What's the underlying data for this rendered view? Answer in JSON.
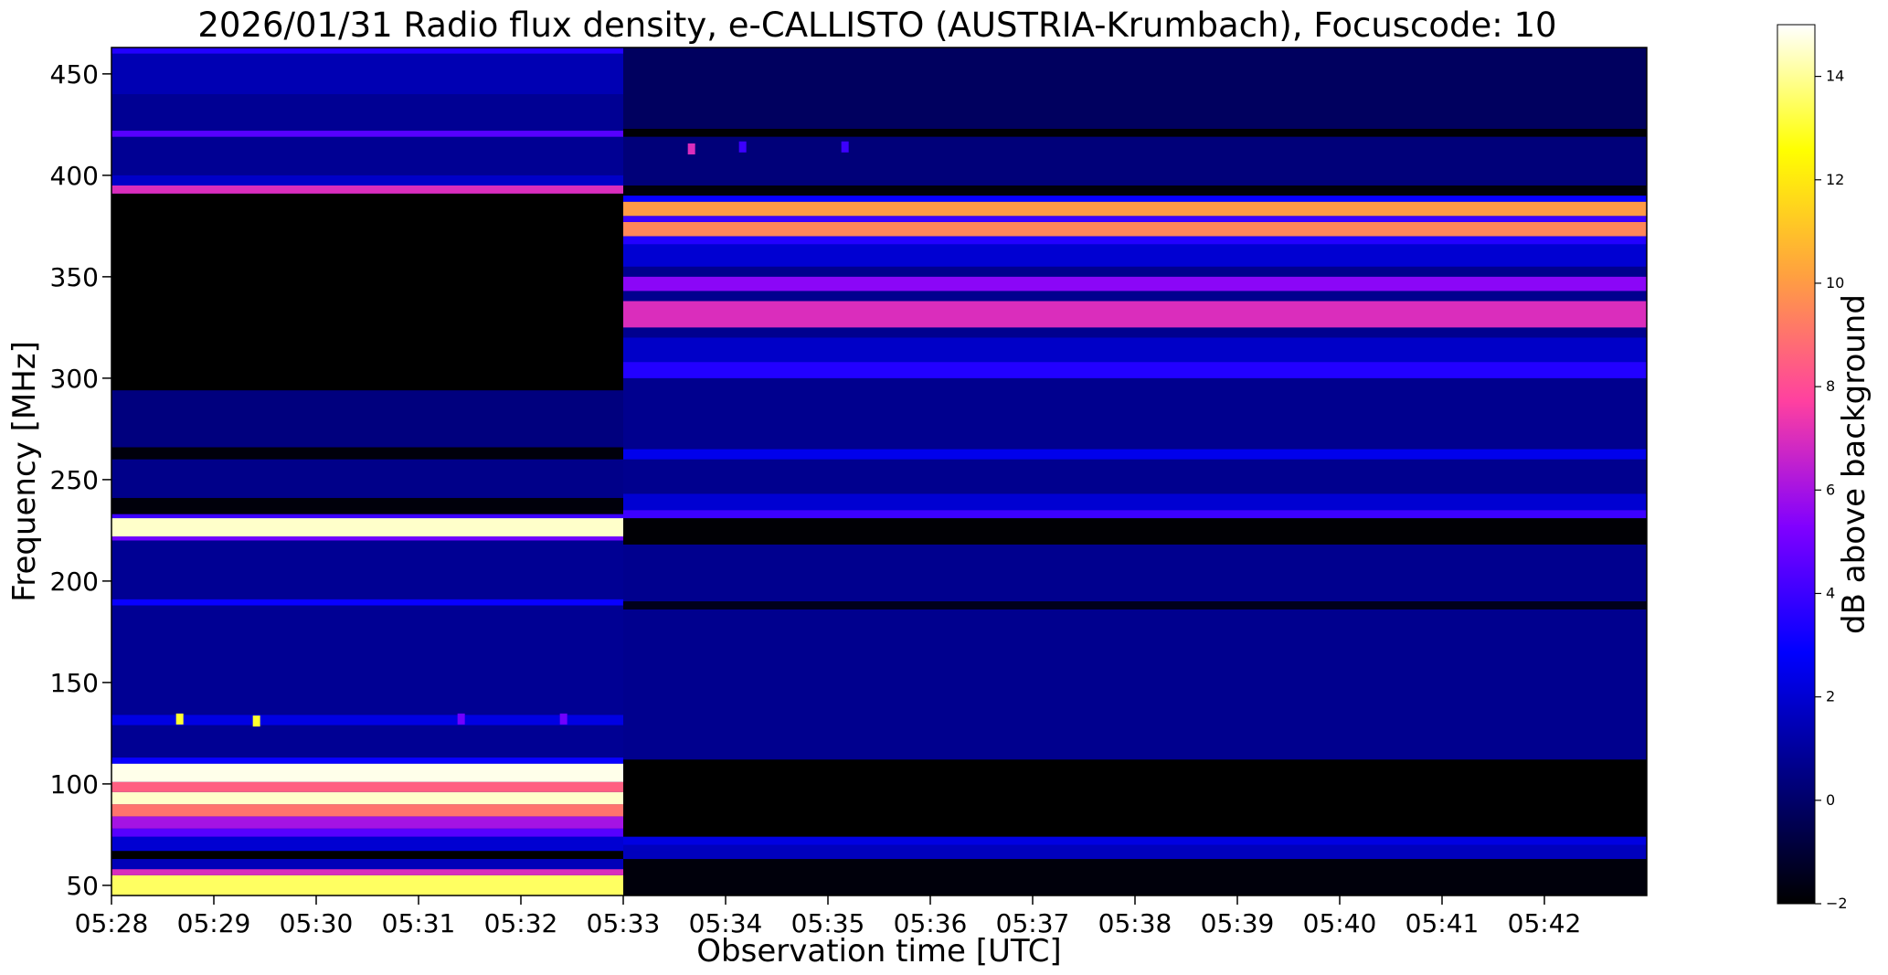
{
  "chart_data": {
    "type": "heatmap",
    "title": "2026/01/31  Radio flux density, e-CALLISTO (AUSTRIA-Krumbach), Focuscode: 10",
    "xlabel": "Observation time [UTC]",
    "ylabel": "Frequency [MHz]",
    "x_ticks": [
      "05:28",
      "05:29",
      "05:30",
      "05:31",
      "05:32",
      "05:33",
      "05:34",
      "05:35",
      "05:36",
      "05:37",
      "05:38",
      "05:39",
      "05:40",
      "05:41",
      "05:42"
    ],
    "xlim": [
      "05:28",
      "05:43"
    ],
    "y_ticks": [
      50,
      100,
      150,
      200,
      250,
      300,
      350,
      400,
      450
    ],
    "ylim": [
      45,
      463
    ],
    "colorbar": {
      "label": "dB above background",
      "ticks": [
        -2,
        0,
        2,
        4,
        6,
        8,
        10,
        12,
        14
      ],
      "range": [
        -2,
        15
      ],
      "colormap": "gnuplot2",
      "stops": [
        "#000000",
        "#000080",
        "#0000ff",
        "#8000ff",
        "#ff40a0",
        "#ffa040",
        "#ffff00",
        "#ffffff"
      ]
    },
    "segments": [
      {
        "time_range": [
          "05:28",
          "05:33"
        ],
        "background_db": 0.8,
        "bands": [
          {
            "freq": [
              45,
              55
            ],
            "db": 13.5
          },
          {
            "freq": [
              55,
              58
            ],
            "db": 7
          },
          {
            "freq": [
              58,
              63
            ],
            "db": 1.5
          },
          {
            "freq": [
              63,
              67
            ],
            "db": -2
          },
          {
            "freq": [
              67,
              74
            ],
            "db": 2
          },
          {
            "freq": [
              74,
              78
            ],
            "db": 4.5
          },
          {
            "freq": [
              78,
              84
            ],
            "db": 6
          },
          {
            "freq": [
              84,
              90
            ],
            "db": 9
          },
          {
            "freq": [
              90,
              96
            ],
            "db": 14.5
          },
          {
            "freq": [
              96,
              101
            ],
            "db": 8.5
          },
          {
            "freq": [
              101,
              110
            ],
            "db": 14.8
          },
          {
            "freq": [
              110,
              113
            ],
            "db": 3
          },
          {
            "freq": [
              129,
              134
            ],
            "db": 2.3
          },
          {
            "freq": [
              188,
              191
            ],
            "db": 3
          },
          {
            "freq": [
              220,
              222
            ],
            "db": 5
          },
          {
            "freq": [
              222,
              231
            ],
            "db": 14.5
          },
          {
            "freq": [
              231,
              233
            ],
            "db": 4
          },
          {
            "freq": [
              233,
              241
            ],
            "db": -1.8
          },
          {
            "freq": [
              241,
              260
            ],
            "db": 0.6
          },
          {
            "freq": [
              260,
              266
            ],
            "db": -1.8
          },
          {
            "freq": [
              266,
              294
            ],
            "db": 0.4
          },
          {
            "freq": [
              294,
              391
            ],
            "db": -2
          },
          {
            "freq": [
              391,
              395
            ],
            "db": 7
          },
          {
            "freq": [
              395,
              400
            ],
            "db": 1.8
          },
          {
            "freq": [
              419,
              422
            ],
            "db": 4.5
          },
          {
            "freq": [
              440,
              460
            ],
            "db": 1.4
          },
          {
            "freq": [
              460,
              463
            ],
            "db": 3.5
          }
        ]
      },
      {
        "time_range": [
          "05:33",
          "05:43"
        ],
        "background_db": 0.7,
        "bands": [
          {
            "freq": [
              45,
              63
            ],
            "db": -1.8
          },
          {
            "freq": [
              63,
              70
            ],
            "db": 1.6
          },
          {
            "freq": [
              70,
              74
            ],
            "db": 2.3
          },
          {
            "freq": [
              74,
              112
            ],
            "db": -2
          },
          {
            "freq": [
              186,
              190
            ],
            "db": -1.5
          },
          {
            "freq": [
              218,
              231
            ],
            "db": -1.9
          },
          {
            "freq": [
              231,
              235
            ],
            "db": 4
          },
          {
            "freq": [
              235,
              243
            ],
            "db": 2
          },
          {
            "freq": [
              260,
              265
            ],
            "db": 2.5
          },
          {
            "freq": [
              300,
              308
            ],
            "db": 3.5
          },
          {
            "freq": [
              308,
              320
            ],
            "db": 1.8
          },
          {
            "freq": [
              325,
              338
            ],
            "db": 7
          },
          {
            "freq": [
              343,
              350
            ],
            "db": 5.5
          },
          {
            "freq": [
              355,
              366
            ],
            "db": 2
          },
          {
            "freq": [
              366,
              370
            ],
            "db": 3.5
          },
          {
            "freq": [
              370,
              377
            ],
            "db": 9.5
          },
          {
            "freq": [
              377,
              380
            ],
            "db": 4
          },
          {
            "freq": [
              380,
              387
            ],
            "db": 10
          },
          {
            "freq": [
              387,
              390
            ],
            "db": 3
          },
          {
            "freq": [
              390,
              395
            ],
            "db": -1.8
          },
          {
            "freq": [
              395,
              419
            ],
            "db": 0.3
          },
          {
            "freq": [
              419,
              423
            ],
            "db": -1.9
          },
          {
            "freq": [
              423,
              463
            ],
            "db": -0.2
          }
        ]
      }
    ],
    "spots": [
      {
        "time": "05:28:40",
        "freq": 132,
        "db": 13
      },
      {
        "time": "05:29:25",
        "freq": 131,
        "db": 13
      },
      {
        "time": "05:31:25",
        "freq": 132,
        "db": 5
      },
      {
        "time": "05:32:25",
        "freq": 132,
        "db": 5
      },
      {
        "time": "05:33:40",
        "freq": 413,
        "db": 7
      },
      {
        "time": "05:34:10",
        "freq": 414,
        "db": 4
      },
      {
        "time": "05:35:10",
        "freq": 414,
        "db": 4
      }
    ]
  }
}
